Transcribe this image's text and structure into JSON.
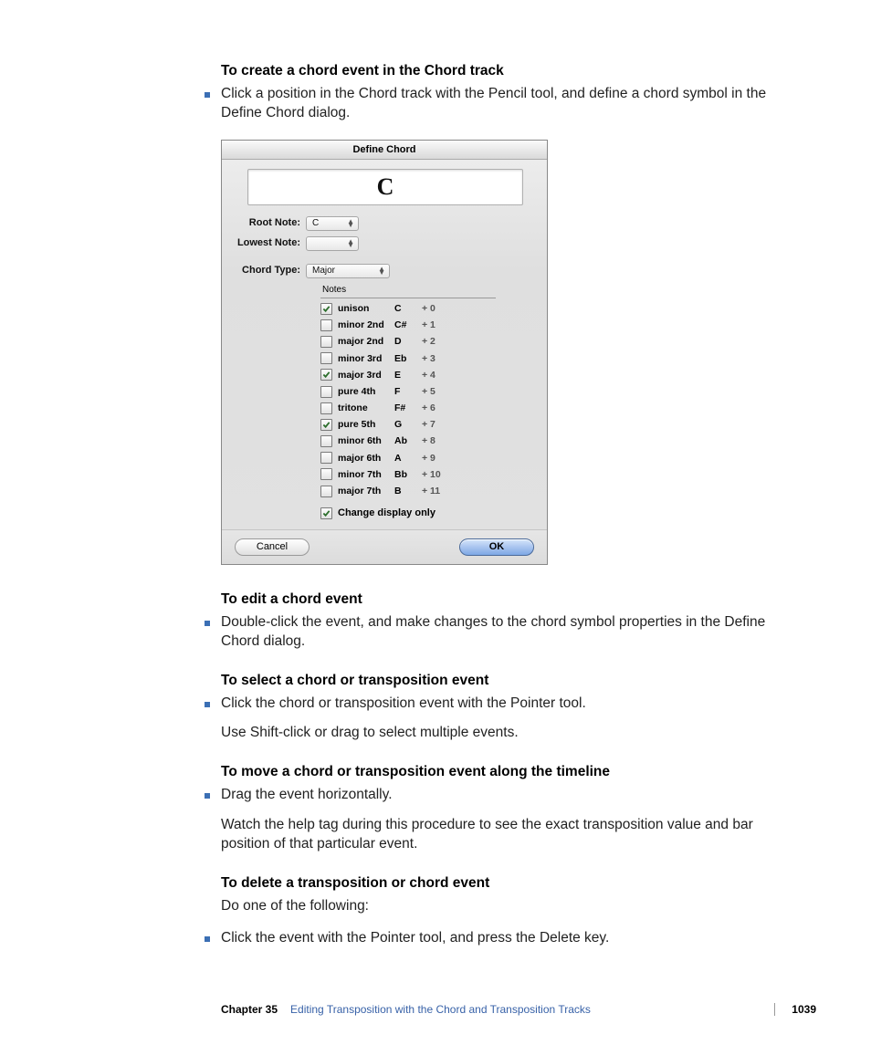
{
  "headings": {
    "createChordEvent": "To create a chord event in the Chord track",
    "editChordEvent": "To edit a chord event",
    "selectChordEvent": "To select a chord or transposition event",
    "moveEvent": "To move a chord or transposition event along the timeline",
    "deleteEvent": "To delete a transposition or chord event"
  },
  "body": {
    "createChord": "Click a position in the Chord track with the Pencil tool, and define a chord symbol in the Define Chord dialog.",
    "editChord": "Double-click the event, and make changes to the chord symbol properties in the Define Chord dialog.",
    "selectChord": "Click the chord or transposition event with the Pointer tool.",
    "selectChordSub": "Use Shift-click or drag to select multiple events.",
    "moveEvent": "Drag the event horizontally.",
    "moveEventSub": "Watch the help tag during this procedure to see the exact transposition value and bar position of that particular event.",
    "deleteEventSub": "Do one of the following:",
    "deleteEventBullet": "Click the event with the Pointer tool, and press the Delete key."
  },
  "dialog": {
    "title": "Define Chord",
    "chordDisplay": "C",
    "rootNoteLabel": "Root Note:",
    "rootNoteValue": "C",
    "lowestNoteLabel": "Lowest Note:",
    "lowestNoteValue": "",
    "chordTypeLabel": "Chord Type:",
    "chordTypeValue": "Major",
    "notesHeader": "Notes",
    "notes": [
      {
        "checked": true,
        "name": "unison",
        "pitch": "C",
        "off": "+ 0"
      },
      {
        "checked": false,
        "name": "minor 2nd",
        "pitch": "C#",
        "off": "+ 1"
      },
      {
        "checked": false,
        "name": "major 2nd",
        "pitch": "D",
        "off": "+ 2"
      },
      {
        "checked": false,
        "name": "minor 3rd",
        "pitch": "Eb",
        "off": "+ 3"
      },
      {
        "checked": true,
        "name": "major 3rd",
        "pitch": "E",
        "off": "+ 4"
      },
      {
        "checked": false,
        "name": "pure   4th",
        "pitch": "F",
        "off": "+ 5"
      },
      {
        "checked": false,
        "name": "tritone",
        "pitch": "F#",
        "off": "+ 6"
      },
      {
        "checked": true,
        "name": "pure   5th",
        "pitch": "G",
        "off": "+ 7"
      },
      {
        "checked": false,
        "name": "minor 6th",
        "pitch": "Ab",
        "off": "+ 8"
      },
      {
        "checked": false,
        "name": "major 6th",
        "pitch": "A",
        "off": "+ 9"
      },
      {
        "checked": false,
        "name": "minor 7th",
        "pitch": "Bb",
        "off": "+ 10"
      },
      {
        "checked": false,
        "name": "major 7th",
        "pitch": "B",
        "off": "+ 11"
      }
    ],
    "changeDisplayOnly": "Change display only",
    "changeDisplayOnlyChecked": true,
    "cancel": "Cancel",
    "ok": "OK"
  },
  "footer": {
    "chapterLabel": "Chapter 35",
    "chapterTitle": "Editing Transposition with the Chord and Transposition Tracks",
    "pageNumber": "1039"
  }
}
